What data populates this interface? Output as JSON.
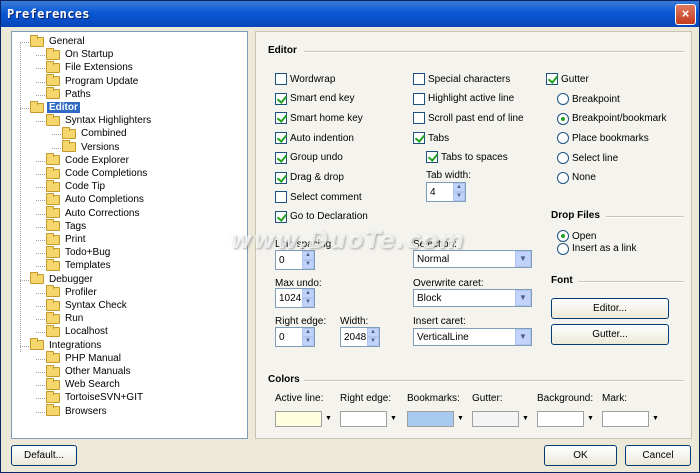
{
  "window": {
    "title": "Preferences",
    "close": "×"
  },
  "tree": [
    {
      "label": "General",
      "level": 0
    },
    {
      "label": "On Startup",
      "level": 1
    },
    {
      "label": "File Extensions",
      "level": 1
    },
    {
      "label": "Program Update",
      "level": 1
    },
    {
      "label": "Paths",
      "level": 1
    },
    {
      "label": "Editor",
      "level": 0,
      "selected": true
    },
    {
      "label": "Syntax Highlighters",
      "level": 1
    },
    {
      "label": "Combined",
      "level": 2
    },
    {
      "label": "Versions",
      "level": 2
    },
    {
      "label": "Code Explorer",
      "level": 1
    },
    {
      "label": "Code Completions",
      "level": 1
    },
    {
      "label": "Code Tip",
      "level": 1
    },
    {
      "label": "Auto Completions",
      "level": 1
    },
    {
      "label": "Auto Corrections",
      "level": 1
    },
    {
      "label": "Tags",
      "level": 1
    },
    {
      "label": "Print",
      "level": 1
    },
    {
      "label": "Todo+Bug",
      "level": 1
    },
    {
      "label": "Templates",
      "level": 1
    },
    {
      "label": "Debugger",
      "level": 0
    },
    {
      "label": "Profiler",
      "level": 1
    },
    {
      "label": "Syntax Check",
      "level": 1
    },
    {
      "label": "Run",
      "level": 1
    },
    {
      "label": "Localhost",
      "level": 1
    },
    {
      "label": "Integrations",
      "level": 0
    },
    {
      "label": "PHP Manual",
      "level": 1
    },
    {
      "label": "Other Manuals",
      "level": 1
    },
    {
      "label": "Web Search",
      "level": 1
    },
    {
      "label": "TortoiseSVN+GIT",
      "level": 1
    },
    {
      "label": "Browsers",
      "level": 1
    }
  ],
  "editor": {
    "title": "Editor",
    "col1": [
      {
        "label": "Wordwrap",
        "checked": false
      },
      {
        "label": "Smart end key",
        "checked": true
      },
      {
        "label": "Smart home key",
        "checked": true
      },
      {
        "label": "Auto indention",
        "checked": true
      },
      {
        "label": "Group undo",
        "checked": true
      },
      {
        "label": "Drag & drop",
        "checked": true
      },
      {
        "label": "Select comment",
        "checked": false
      },
      {
        "label": "Go to Declaration",
        "checked": true
      }
    ],
    "col2": [
      {
        "label": "Special characters",
        "checked": false
      },
      {
        "label": "Highlight active line",
        "checked": false
      },
      {
        "label": "Scroll past end of line",
        "checked": false
      },
      {
        "label": "Tabs",
        "checked": true
      }
    ],
    "tabs_to_spaces": {
      "label": "Tabs to spaces",
      "checked": true
    },
    "tab_width": {
      "label": "Tab width:",
      "value": "4"
    },
    "gutter": {
      "label": "Gutter",
      "checked": true
    },
    "gutter_options": [
      {
        "label": "Breakpoint",
        "checked": false
      },
      {
        "label": "Breakpoint/bookmark",
        "checked": true
      },
      {
        "label": "Place bookmarks",
        "checked": false
      },
      {
        "label": "Select line",
        "checked": false
      },
      {
        "label": "None",
        "checked": false
      }
    ],
    "line_spacing": {
      "label": "Line spacing:",
      "value": "0"
    },
    "selection": {
      "label": "Selection:",
      "value": "Normal"
    },
    "max_undo": {
      "label": "Max undo:",
      "value": "1024"
    },
    "overwrite_caret": {
      "label": "Overwrite caret:",
      "value": "Block"
    },
    "right_edge": {
      "label": "Right edge:",
      "value": "0"
    },
    "width": {
      "label": "Width:",
      "value": "2048"
    },
    "insert_caret": {
      "label": "Insert caret:",
      "value": "VerticalLine"
    }
  },
  "drop_files": {
    "title": "Drop Files",
    "options": [
      {
        "label": "Open",
        "checked": true
      },
      {
        "label": "Insert as a link",
        "checked": false
      }
    ]
  },
  "font": {
    "title": "Font",
    "editor_button": "Editor...",
    "gutter_button": "Gutter..."
  },
  "colors": {
    "title": "Colors",
    "items": [
      {
        "label": "Active line:",
        "color": "#ffffe0"
      },
      {
        "label": "Right edge:",
        "color": "#ffffff"
      },
      {
        "label": "Bookmarks:",
        "color": "#a6caf0"
      },
      {
        "label": "Gutter:",
        "color": "#f4f4f4"
      },
      {
        "label": "Background:",
        "color": "#ffffff"
      },
      {
        "label": "Mark:",
        "color": "#ffffff"
      }
    ]
  },
  "footer": {
    "default_button": "Default...",
    "ok_button": "OK",
    "cancel_button": "Cancel"
  },
  "watermark": {
    "text": "www.DuoTe.com"
  }
}
